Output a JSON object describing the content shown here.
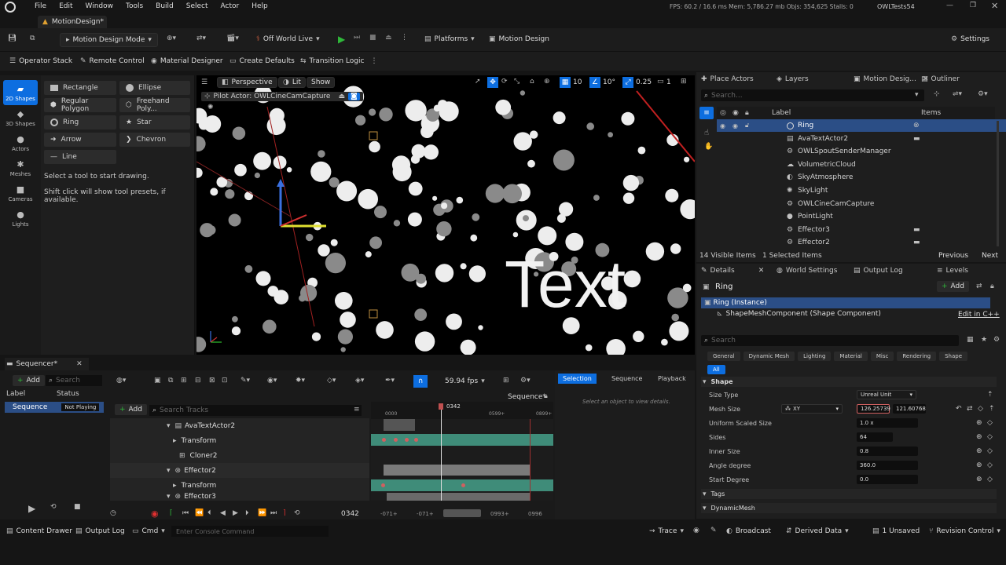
{
  "titlebar": {
    "menus": [
      "File",
      "Edit",
      "Window",
      "Tools",
      "Build",
      "Select",
      "Actor",
      "Help"
    ],
    "stats": "FPS: 60.2 / 16.6 ms  Mem: 5,786.27 mb  Objs: 354,625  Stalls: 0",
    "project": "OWLTests54"
  },
  "tab": {
    "label": "MotionDesign*"
  },
  "toolbar": {
    "mode_label": "Motion Design Mode",
    "world_label": "Off World Live",
    "platforms_label": "Platforms",
    "motion_design_label": "Motion Design",
    "settings_label": "Settings"
  },
  "toolbar2": {
    "items": [
      "Operator Stack",
      "Remote Control",
      "Material Designer",
      "Create Defaults",
      "Transition Logic"
    ]
  },
  "modes": [
    "2D Shapes",
    "3D Shapes",
    "Actors",
    "Meshes",
    "Cameras",
    "Lights"
  ],
  "shapes": {
    "items": [
      "Rectangle",
      "Ellipse",
      "Regular Polygon",
      "Freehand Poly...",
      "Ring",
      "Star",
      "Arrow",
      "Chevron",
      "Line"
    ],
    "help1": "Select a tool to start drawing.",
    "help2": "Shift click will show tool presets, if available."
  },
  "viewport": {
    "perspective": "Perspective",
    "lit": "Lit",
    "show": "Show",
    "pilot": "Pilot Actor: OWLCineCamCapture",
    "grid": "10",
    "angle": "10°",
    "scale": "0.25",
    "cam": "1",
    "text3d": "Text"
  },
  "outliner": {
    "tabs": [
      "Place Actors",
      "Layers",
      "Motion Desig...",
      "Outliner"
    ],
    "search_placeholder": "Search...",
    "col_label": "Label",
    "col_items": "Items",
    "rows": [
      "Ring",
      "AvaTextActor2",
      "OWLSpoutSenderManager",
      "VolumetricCloud",
      "SkyAtmosphere",
      "SkyLight",
      "OWLCineCamCapture",
      "PointLight",
      "Effector3",
      "Effector2"
    ],
    "footer_visible": "14 Visible Items",
    "footer_selected": "1 Selected Items",
    "prev": "Previous",
    "next": "Next"
  },
  "details": {
    "tabs": [
      "Details",
      "World Settings",
      "Output Log",
      "Levels"
    ],
    "title": "Ring",
    "add": "Add",
    "instance": "Ring (Instance)",
    "component": "ShapeMeshComponent (Shape Component)",
    "edit_cpp": "Edit in C++",
    "search_placeholder": "Search",
    "categories": [
      "General",
      "Dynamic Mesh",
      "Lighting",
      "Material",
      "Misc",
      "Rendering",
      "Shape"
    ],
    "all": "All",
    "section_shape": "Shape",
    "props": [
      {
        "label": "Size Type",
        "value": "Unreal Unit"
      },
      {
        "label": "Mesh Size",
        "value": "126.25739"
      },
      {
        "label": "Uniform Scaled Size",
        "value": "1.0 x"
      },
      {
        "label": "Sides",
        "value": "64"
      },
      {
        "label": "Inner Size",
        "value": "0.8"
      },
      {
        "label": "Angle degree",
        "value": "360.0"
      },
      {
        "label": "Start Degree",
        "value": "0.0"
      }
    ],
    "mesh_axis": "XY",
    "mesh_size_y": "121.60768",
    "section_tags": "Tags",
    "section_dynmesh": "DynamicMesh"
  },
  "sequencer": {
    "tab": "Sequencer*",
    "add": "Add",
    "search": "Search",
    "col_label": "Label",
    "col_status": "Status",
    "seq_name": "Sequence",
    "seq_status": "Not Playing",
    "fps": "59.94 fps",
    "seq_breadcrumb": "Sequence*",
    "search_tracks": "Search Tracks",
    "tracks": [
      "AvaTextActor2",
      "Transform",
      "Cloner2",
      "Effector2",
      "Transform",
      "Effector3"
    ],
    "ruler": [
      "0000",
      "0342",
      "0599+",
      "0899+"
    ],
    "current_frame": "0342",
    "range": [
      "-071+",
      "-071+",
      "0993+",
      "0996"
    ],
    "mode_tabs": [
      "Selection",
      "Sequence",
      "Playback"
    ],
    "empty": "Select an object to view details."
  },
  "statusbar": {
    "left": [
      "Content Drawer",
      "Output Log",
      "Cmd"
    ],
    "console_placeholder": "Enter Console Command",
    "right": [
      "Trace",
      "Broadcast",
      "Derived Data",
      "1 Unsaved",
      "Revision Control"
    ]
  },
  "colors": {
    "accent": "#0d6ee0",
    "track_green": "#3f8c79",
    "key_red": "#d06060",
    "play_green": "#2fb83a",
    "record_red": "#e03030"
  }
}
